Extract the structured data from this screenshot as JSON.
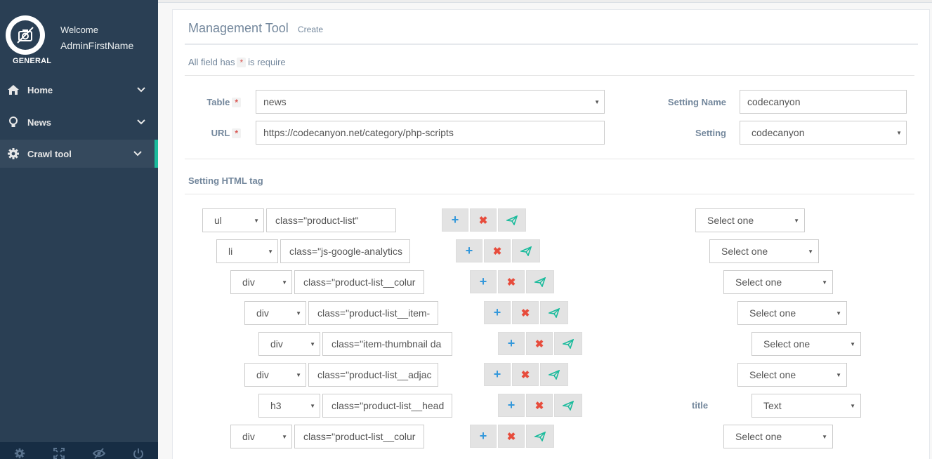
{
  "sidebar": {
    "profile": {
      "welcome": "Welcome",
      "username": "AdminFirstName",
      "badge": "GENERAL"
    },
    "menu": [
      {
        "label": "Home",
        "icon": "home-icon"
      },
      {
        "label": "News",
        "icon": "lightbulb-icon"
      },
      {
        "label": "Crawl tool",
        "icon": "gear-icon",
        "active": true
      }
    ],
    "footer_icons": [
      "settings-icon",
      "fullscreen-icon",
      "hide-icon",
      "power-icon"
    ]
  },
  "panel": {
    "title": "Management Tool",
    "subtitle": "Create",
    "required_note_prefix": "All field has",
    "required_mark": "*",
    "required_note_suffix": "is require"
  },
  "form": {
    "table_label": "Table",
    "table_value": "news",
    "url_label": "URL",
    "url_value": "https://codecanyon.net/category/php-scripts",
    "setting_name_label": "Setting Name",
    "setting_name_value": "codecanyon",
    "setting_label": "Setting",
    "setting_value": "codecanyon"
  },
  "tags_section": {
    "title": "Setting HTML tag",
    "rows": [
      {
        "tag": "ul",
        "attr": "class=\"product-list\"",
        "label": "",
        "pick": "Select one"
      },
      {
        "tag": "li",
        "attr": "class=\"js-google-analytics",
        "label": "",
        "pick": "Select one"
      },
      {
        "tag": "div",
        "attr": "class=\"product-list__colur",
        "label": "",
        "pick": "Select one"
      },
      {
        "tag": "div",
        "attr": "class=\"product-list__item-",
        "label": "",
        "pick": "Select one"
      },
      {
        "tag": "div",
        "attr": "class=\"item-thumbnail da",
        "label": "",
        "pick": "Select one"
      },
      {
        "tag": "div",
        "attr": "class=\"product-list__adjac",
        "label": "",
        "pick": "Select one"
      },
      {
        "tag": "h3",
        "attr": "class=\"product-list__head",
        "label": "title",
        "pick": "Text"
      },
      {
        "tag": "div",
        "attr": "class=\"product-list__colur",
        "label": "",
        "pick": "Select one"
      }
    ]
  },
  "colors": {
    "sidebar": "#2a3f54",
    "accent": "#1abb9c",
    "add": "#3498db",
    "delete": "#e74c3c",
    "send": "#1abb9c"
  }
}
